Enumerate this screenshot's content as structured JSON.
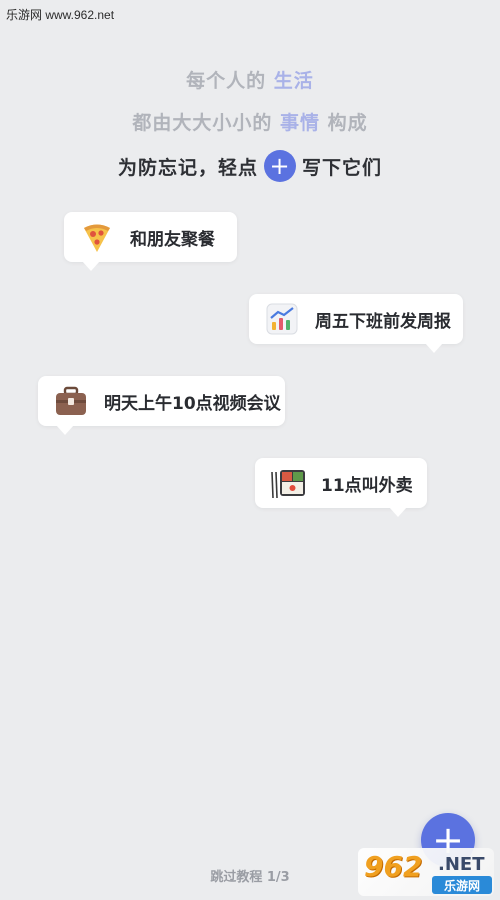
{
  "watermark": {
    "top_text": "乐游网 www.962.net",
    "logo_number": "962",
    "logo_suffix": ".NET",
    "logo_bar": "乐游网"
  },
  "intro": {
    "line1_prefix": "每个人的 ",
    "line1_accent": "生活",
    "line2_prefix": "都由大大小小的 ",
    "line2_accent": "事情",
    "line2_suffix": " 构成",
    "line3_prefix": "为防忘记，轻点",
    "line3_suffix": "写下它们",
    "plus_symbol": "+"
  },
  "cards": [
    {
      "icon": "pizza-icon",
      "text": "和朋友聚餐"
    },
    {
      "icon": "chart-icon",
      "text": "周五下班前发周报"
    },
    {
      "icon": "briefcase-icon",
      "text": "明天上午10点视频会议"
    },
    {
      "icon": "bento-box-icon",
      "text": "11点叫外卖"
    }
  ],
  "footer": {
    "skip_label": "跳过教程 1/3"
  },
  "fab": {
    "symbol": "+"
  },
  "colors": {
    "accent": "#5b72e0",
    "background": "#ebecee",
    "muted_text": "#b1b4bb"
  }
}
